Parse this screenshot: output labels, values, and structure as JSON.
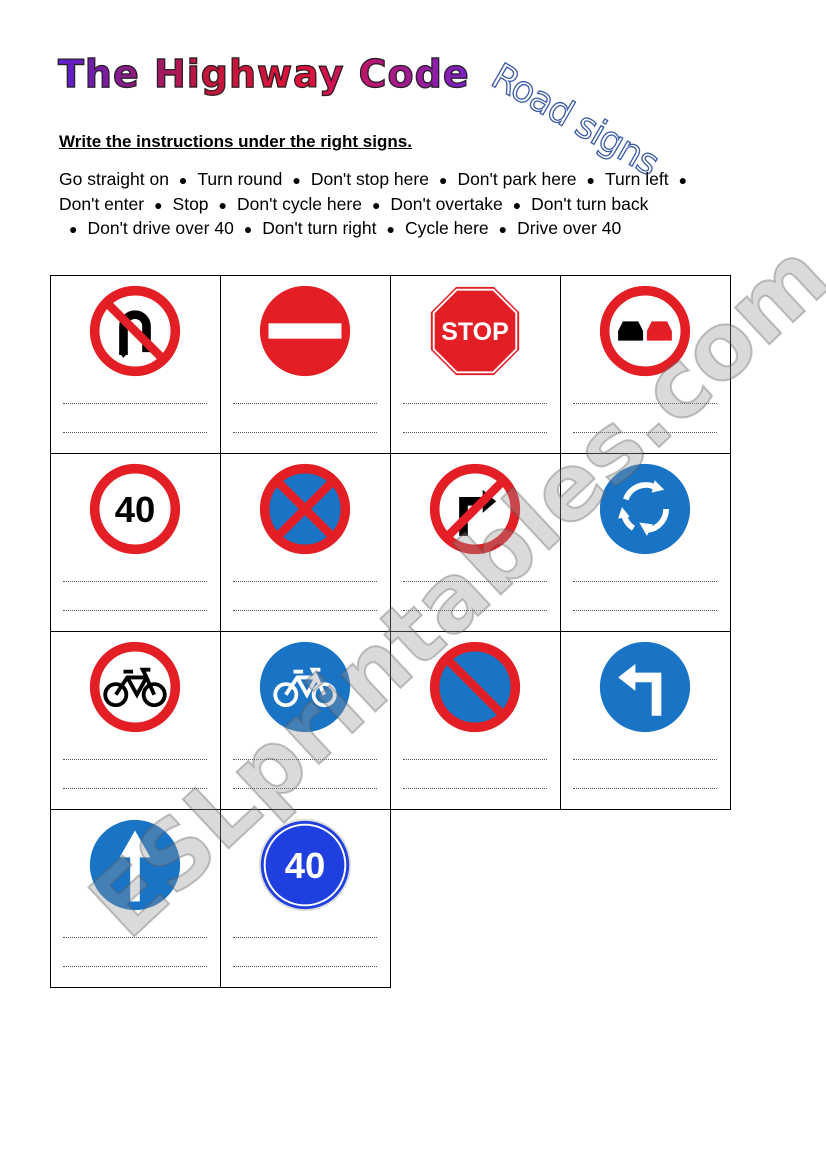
{
  "header": {
    "title": "The Highway Code",
    "subtitle": "Road signs",
    "instruction": "Write the instructions under the right signs."
  },
  "word_bank": {
    "lines": [
      [
        "Go straight on",
        "Turn round",
        "Don't stop here",
        "Don't park here",
        "Turn left",
        ""
      ],
      [
        "Don't enter",
        "Stop",
        "Don't cycle here",
        "Don't overtake",
        "Don't turn back"
      ],
      [
        "",
        "Don't drive over 40",
        "Don't turn right",
        "Cycle here",
        "Drive over 40"
      ]
    ]
  },
  "signs": [
    {
      "icon": "no-u-turn-sign"
    },
    {
      "icon": "no-entry-sign"
    },
    {
      "icon": "stop-sign",
      "text": "STOP"
    },
    {
      "icon": "no-overtaking-sign"
    },
    {
      "icon": "speed-limit-40-sign",
      "text": "40"
    },
    {
      "icon": "no-stopping-sign"
    },
    {
      "icon": "no-right-turn-sign"
    },
    {
      "icon": "roundabout-sign"
    },
    {
      "icon": "no-cycling-sign"
    },
    {
      "icon": "cycle-route-sign"
    },
    {
      "icon": "no-waiting-sign"
    },
    {
      "icon": "turn-left-sign"
    },
    {
      "icon": "ahead-only-sign"
    },
    {
      "icon": "minimum-speed-40-sign",
      "text": "40"
    }
  ],
  "colors": {
    "red": "#e31e24",
    "blue": "#1a74c6",
    "bright_blue": "#1f3fe0"
  },
  "watermark": "ESLprintables.com"
}
